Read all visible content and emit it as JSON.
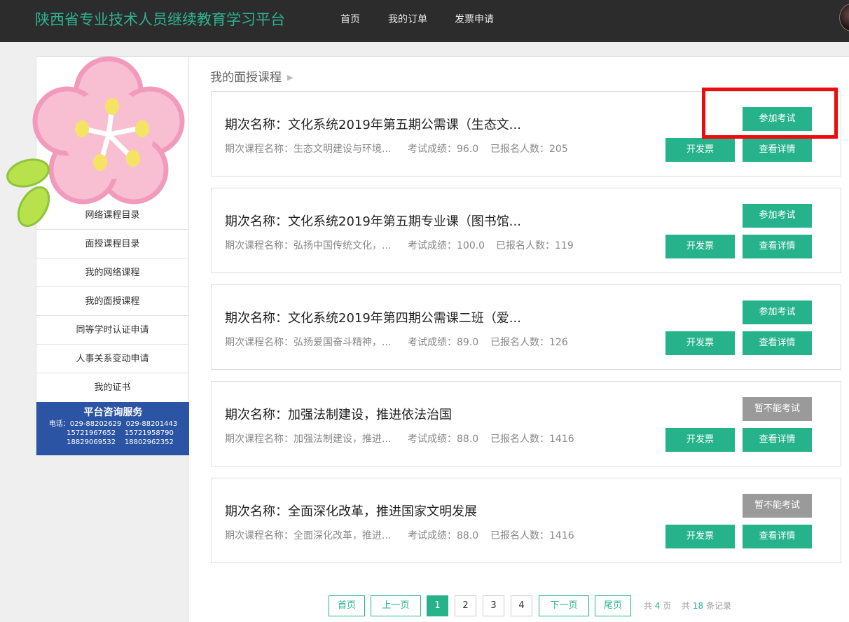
{
  "header": {
    "title": "陕西省专业技术人员继续教育学习平台",
    "nav": [
      "首页",
      "我的订单",
      "发票申请"
    ]
  },
  "sidebar": {
    "items": [
      "网络课程目录",
      "面授课程目录",
      "我的网络课程",
      "我的面授课程",
      "同等学时认证申请",
      "人事关系变动申请",
      "我的证书"
    ],
    "consult": {
      "title": "平台咨询服务",
      "phone_label": "电话：",
      "phones": [
        "029-88202629",
        "029-88201443",
        "15721967652",
        "15721958790",
        "18829069532",
        "18802962352"
      ]
    }
  },
  "main": {
    "breadcrumb": "我的面授课程",
    "courses": [
      {
        "title": "期次名称：文化系统2019年第五期公需课（生态文...",
        "course_name": "期次课程名称：生态文明建设与环境...",
        "score": "考试成绩：96.0",
        "enrolled": "已报名人数：205",
        "exam_button": "参加考试",
        "exam_enabled": true
      },
      {
        "title": "期次名称：文化系统2019年第五期专业课（图书馆...",
        "course_name": "期次课程名称：弘扬中国传统文化，...",
        "score": "考试成绩：100.0",
        "enrolled": "已报名人数：119",
        "exam_button": "参加考试",
        "exam_enabled": true
      },
      {
        "title": "期次名称：文化系统2019年第四期公需课二班（爱...",
        "course_name": "期次课程名称：弘扬爱国奋斗精神，...",
        "score": "考试成绩：89.0",
        "enrolled": "已报名人数：126",
        "exam_button": "参加考试",
        "exam_enabled": true
      },
      {
        "title": "期次名称：加强法制建设，推进依法治国",
        "course_name": "期次课程名称：加强法制建设，推进...",
        "score": "考试成绩：88.0",
        "enrolled": "已报名人数：1416",
        "exam_button": "暂不能考试",
        "exam_enabled": false
      },
      {
        "title": "期次名称：全面深化改革，推进国家文明发展",
        "course_name": "期次课程名称：全面深化改革，推进...",
        "score": "考试成绩：88.0",
        "enrolled": "已报名人数：1416",
        "exam_button": "暂不能考试",
        "exam_enabled": false
      }
    ],
    "invoice_label": "开发票",
    "detail_label": "查看详情"
  },
  "pagination": {
    "first": "首页",
    "prev": "上一页",
    "pages": [
      "1",
      "2",
      "3",
      "4"
    ],
    "current_page": 1,
    "next": "下一页",
    "last": "尾页",
    "total_pages_prefix": "共",
    "total_pages": "4",
    "total_pages_suffix": "页",
    "total_records_prefix": "共",
    "total_records": "18",
    "total_records_suffix": "条记录"
  },
  "colors": {
    "accent": "#26b38c",
    "brand_text": "#2db38f",
    "topbar": "#2c2c2c",
    "consult_bg": "#2b54a4",
    "disabled": "#9a9a9a",
    "highlight": "#ee0b0b"
  }
}
